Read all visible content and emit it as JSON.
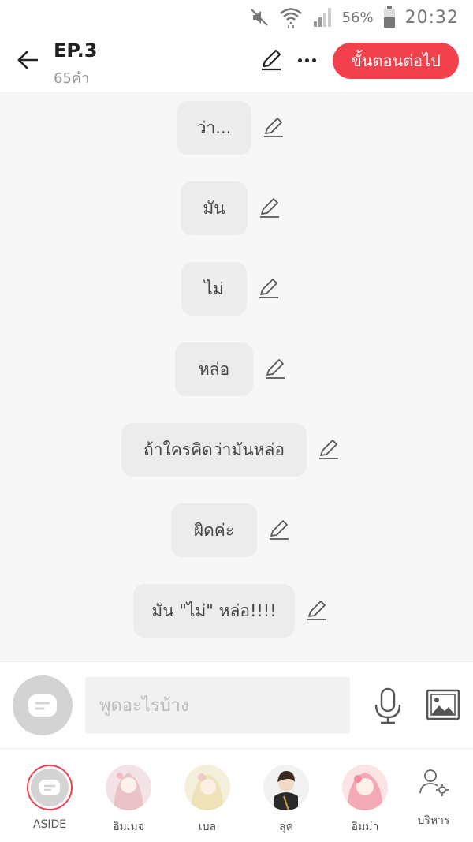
{
  "status_bar": {
    "battery_percent": "56%",
    "time": "20:32",
    "icons": [
      "mute-icon",
      "wifi-icon",
      "signal-icon",
      "battery-icon"
    ]
  },
  "header": {
    "title": "EP.3",
    "word_count": "65คำ",
    "next_button_label": "ขั้นตอนต่อไป",
    "accent_color": "#f2414c"
  },
  "messages": [
    {
      "text": "ว่า..."
    },
    {
      "text": "มัน"
    },
    {
      "text": "ไม่"
    },
    {
      "text": "หล่อ"
    },
    {
      "text": "ถ้าใครคิดว่ามันหล่อ"
    },
    {
      "text": "ผิดค่ะ"
    },
    {
      "text": "มัน \"ไม่\" หล่อ!!!!"
    }
  ],
  "composer": {
    "placeholder": "พูดอะไรบ้าง",
    "value": ""
  },
  "characters": [
    {
      "label": "ASIDE",
      "selected": true
    },
    {
      "label": "อิมเมจ"
    },
    {
      "label": "เบล"
    },
    {
      "label": "ลุค"
    },
    {
      "label": "อิมม่า"
    }
  ],
  "manage_label": "บริหาร"
}
